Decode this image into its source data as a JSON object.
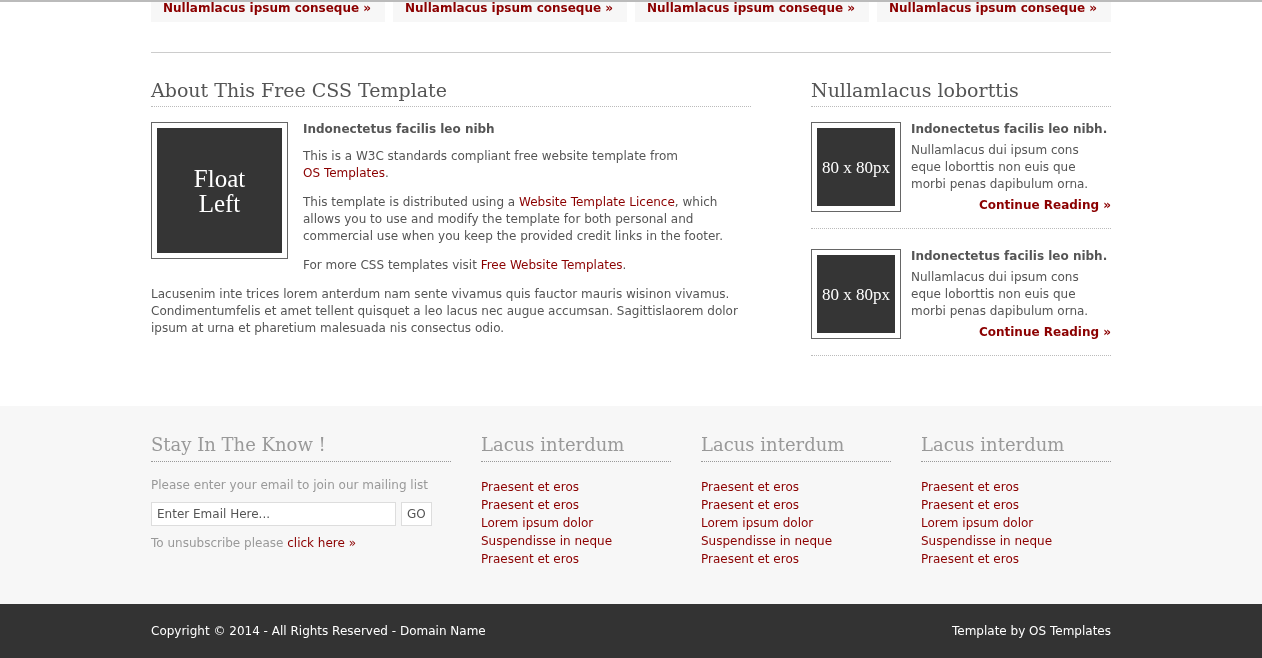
{
  "top_links": [
    "Nullamlacus ipsum conseque »",
    "Nullamlacus ipsum conseque »",
    "Nullamlacus ipsum conseque »",
    "Nullamlacus ipsum conseque »"
  ],
  "about": {
    "title": "About This Free CSS Template",
    "image_label": "Float Left",
    "subtitle": "Indonectetus facilis leo nibh",
    "paragraphs": [
      [
        {
          "kind": "text",
          "text": "This is a W3C standards compliant free website template from "
        },
        {
          "kind": "link",
          "text": "OS Templates"
        },
        {
          "kind": "text",
          "text": "."
        }
      ],
      [
        {
          "kind": "text",
          "text": "This template is distributed using a "
        },
        {
          "kind": "link",
          "text": "Website Template Licence"
        },
        {
          "kind": "text",
          "text": ", which allows you to use and modify the template for both personal and commercial use when you keep the provided credit links in the footer."
        }
      ],
      [
        {
          "kind": "text",
          "text": "For more CSS templates visit "
        },
        {
          "kind": "link",
          "text": "Free Website Templates"
        },
        {
          "kind": "text",
          "text": "."
        }
      ]
    ],
    "body": "Lacusenim inte trices lorem anterdum nam sente vivamus quis fauctor mauris wisinon vivamus. Condimentumfelis et amet tellent quisquet a leo lacus nec augue accumsan. Sagittislaorem dolor ipsum at urna et pharetium malesuada nis consectus odio."
  },
  "sidebar": {
    "title": "Nullamlacus loborttis",
    "posts": [
      {
        "image_label": "80 x 80px",
        "title": "Indonectetus facilis leo nibh.",
        "text": "Nullamlacus dui ipsum cons eque loborttis non euis que morbi penas dapibulum orna.",
        "link": "Continue Reading »"
      },
      {
        "image_label": "80 x 80px",
        "title": "Indonectetus facilis leo nibh.",
        "text": "Nullamlacus dui ipsum cons eque loborttis non euis que morbi penas dapibulum orna.",
        "link": "Continue Reading »"
      }
    ]
  },
  "newsletter": {
    "title": "Stay In The Know !",
    "intro": "Please enter your email to join our mailing list",
    "placeholder": "Enter Email Here...",
    "button": "GO",
    "unsubscribe_text": "To unsubscribe please ",
    "unsubscribe_link": "click here »"
  },
  "link_columns": [
    {
      "title": "Lacus interdum",
      "links": [
        "Praesent et eros",
        "Praesent et eros",
        "Lorem ipsum dolor",
        "Suspendisse in neque",
        "Praesent et eros"
      ]
    },
    {
      "title": "Lacus interdum",
      "links": [
        "Praesent et eros",
        "Praesent et eros",
        "Lorem ipsum dolor",
        "Suspendisse in neque",
        "Praesent et eros"
      ]
    },
    {
      "title": "Lacus interdum",
      "links": [
        "Praesent et eros",
        "Praesent et eros",
        "Lorem ipsum dolor",
        "Suspendisse in neque",
        "Praesent et eros"
      ]
    }
  ],
  "copyright": "Copyright © 2014 - All Rights Reserved - Domain Name",
  "credit": "Template by OS Templates"
}
